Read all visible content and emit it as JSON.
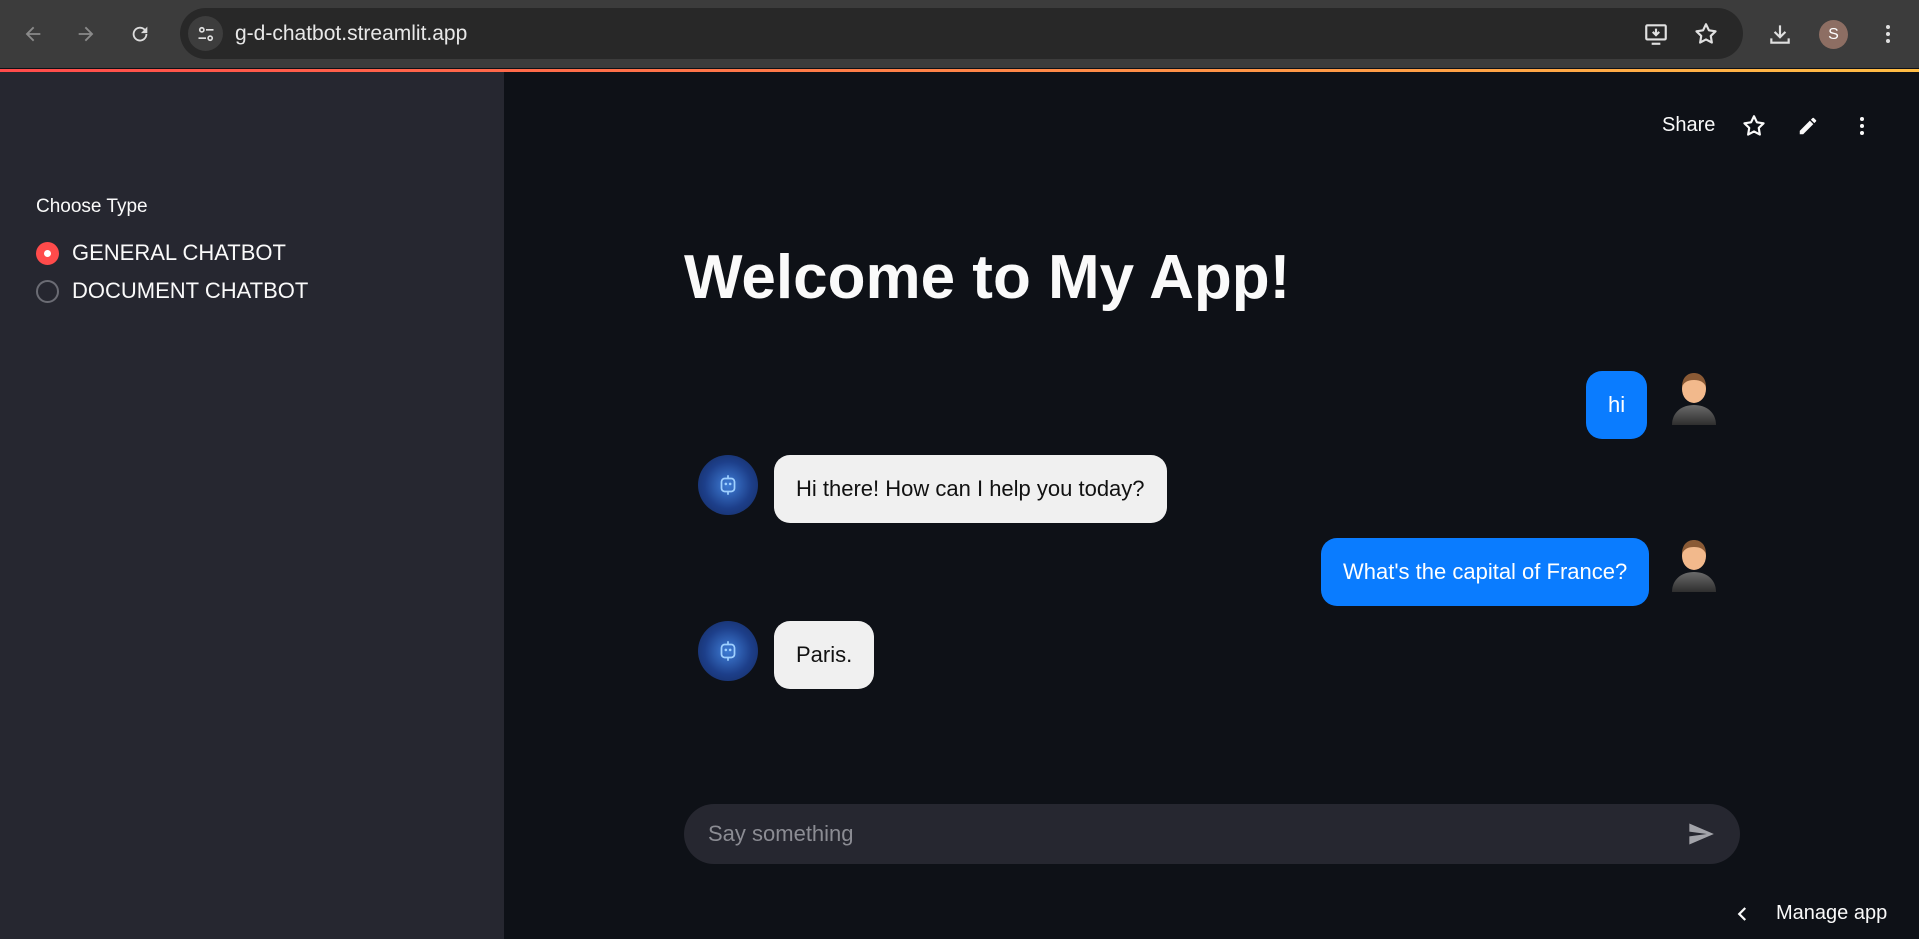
{
  "browser": {
    "url": "g-d-chatbot.streamlit.app",
    "profile_initial": "S"
  },
  "sidebar": {
    "label": "Choose Type",
    "options": [
      {
        "label": "GENERAL CHATBOT",
        "selected": true
      },
      {
        "label": "DOCUMENT CHATBOT",
        "selected": false
      }
    ]
  },
  "toolbar": {
    "share_label": "Share"
  },
  "main": {
    "title": "Welcome to My App!"
  },
  "messages": [
    {
      "role": "user",
      "text": "hi"
    },
    {
      "role": "assistant",
      "text": "Hi there! How can I help you today?"
    },
    {
      "role": "user",
      "text": "What's the capital of France?"
    },
    {
      "role": "assistant",
      "text": "Paris."
    }
  ],
  "chat_input": {
    "placeholder": "Say something"
  },
  "footer": {
    "manage_label": "Manage app"
  },
  "colors": {
    "accent": "#ff4b4b",
    "user_bubble": "#0a7cff",
    "bot_bubble": "#f0f0f0"
  }
}
